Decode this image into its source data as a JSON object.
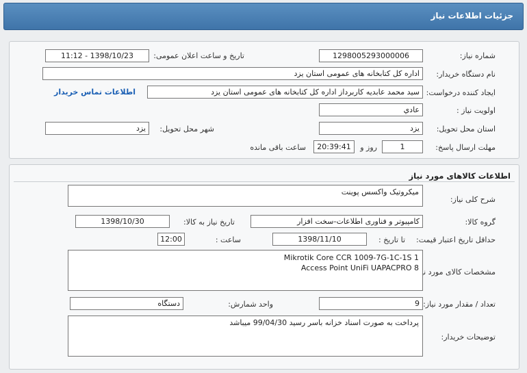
{
  "header": {
    "title": "جزئیات اطلاعات نیاز"
  },
  "info": {
    "need_number_label": "شماره نیاز:",
    "need_number": "1298005293000006",
    "announce_label": "تاریخ و ساعت اعلان عمومی:",
    "announce_value": "1398/10/23 - 11:12",
    "buyer_org_label": "نام دستگاه خریدار:",
    "buyer_org": "اداره کل کتابخانه های عمومی استان یزد",
    "requester_label": "ایجاد کننده درخواست:",
    "requester": "سید محمد عابدیه کاربرداز اداره کل کتابخانه های عمومی استان یزد",
    "contact_link": "اطلاعات تماس خریدار",
    "priority_label": "اولویت نیاز :",
    "priority": "عادي",
    "province_label": "استان محل تحویل:",
    "province": "یزد",
    "city_label": "شهر محل تحویل:",
    "city": "یزد",
    "deadline_label": "مهلت ارسال پاسخ:",
    "deadline_days": "1",
    "days_and": "روز و",
    "deadline_time": "20:39:41",
    "remaining": "ساعت باقی مانده"
  },
  "goods": {
    "section_title": "اطلاعات کالاهای مورد نیاز",
    "general_desc_label": "شرح کلی نیاز:",
    "general_desc": "میکروتیک واکسس پوینت",
    "group_label": "گروه کالا:",
    "group": "کامپیوتر و فناوری اطلاعات-سخت افزار",
    "need_date_label": "تاریخ نیاز به کالا:",
    "need_date": "1398/10/30",
    "validity_label": "حداقل تاریخ اعتبار قیمت:",
    "to_date_label": "تا تاریخ :",
    "validity_date": "1398/11/10",
    "time_label": "ساعت :",
    "validity_time": "12:00",
    "spec_label": "مشخصات کالای مورد نیاز:",
    "spec_lines": [
      "Mikrotik Core CCR 1009-7G-1C-1S 1",
      "Access Point UniFi UAPACPRO 8"
    ],
    "qty_label": "تعداد / مقدار مورد نیاز:",
    "qty": "9",
    "unit_label": "واحد شمارش:",
    "unit": "دستگاه",
    "buyer_notes_label": "توضیحات خریدار:",
    "buyer_notes": "پرداخت به صورت اسناد خزانه باسر رسید 99/04/30 میباشد"
  }
}
